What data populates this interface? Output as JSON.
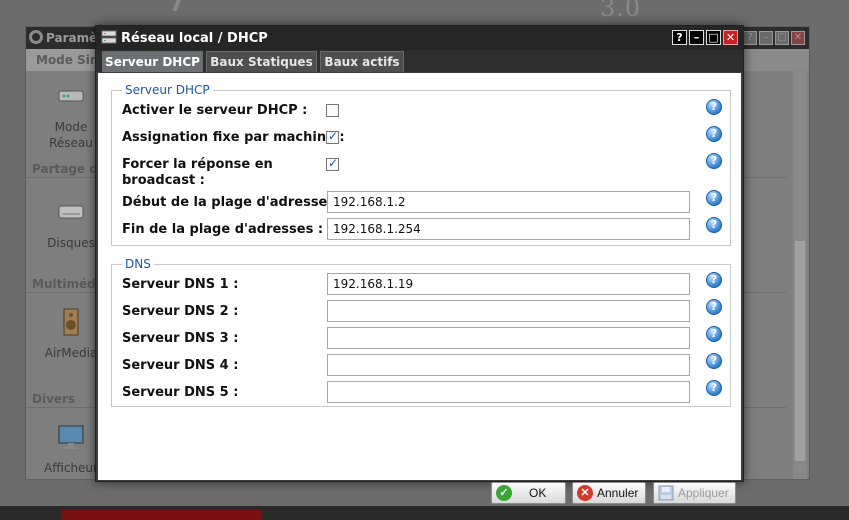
{
  "background": {
    "watermark": "3.0",
    "window_title": "Paramè",
    "tab_partial": "Mode Sim",
    "sections": [
      "Partage d",
      "Multimédi",
      "Divers"
    ],
    "items": [
      {
        "label_line1": "Mode",
        "label_line2": "Réseau",
        "icon": "network-device-icon"
      },
      {
        "label_line1": "Disques",
        "label_line2": "",
        "icon": "hard-disk-icon"
      },
      {
        "label_line1": "AirMedia",
        "label_line2": "",
        "icon": "speaker-icon"
      },
      {
        "label_line1": "Afficheur",
        "label_line2": "",
        "icon": "monitor-icon"
      }
    ],
    "window_buttons": [
      "?",
      "–",
      "□",
      "✕"
    ]
  },
  "dialog": {
    "title": "Réseau local / DHCP",
    "window_buttons": {
      "help": "?",
      "minimize": "–",
      "maximize": "□",
      "close": "✕"
    },
    "tabs": [
      {
        "label": "Serveur DHCP",
        "active": true
      },
      {
        "label": "Baux Statiques",
        "active": false
      },
      {
        "label": "Baux actifs",
        "active": false
      }
    ],
    "dhcp_group": {
      "legend": "Serveur DHCP",
      "enable": {
        "label": "Activer le serveur DHCP :",
        "checked": false
      },
      "fixed": {
        "label": "Assignation fixe par machine :",
        "checked": true
      },
      "broadcast": {
        "label_line1": "Forcer la réponse en",
        "label_line2": "broadcast :",
        "checked": true
      },
      "range_start": {
        "label": "Début de la plage d'adresses :",
        "value": "192.168.1.2"
      },
      "range_end": {
        "label": "Fin de la plage d'adresses :",
        "value": "192.168.1.254"
      }
    },
    "dns_group": {
      "legend": "DNS",
      "servers": [
        {
          "label": "Serveur DNS 1 :",
          "value": "192.168.1.19"
        },
        {
          "label": "Serveur DNS 2 :",
          "value": ""
        },
        {
          "label": "Serveur DNS 3 :",
          "value": ""
        },
        {
          "label": "Serveur DNS 4 :",
          "value": ""
        },
        {
          "label": "Serveur DNS 5 :",
          "value": ""
        }
      ]
    },
    "help_glyph": "?",
    "buttons": {
      "ok": "OK",
      "cancel": "Annuler",
      "apply": "Appliquer"
    }
  },
  "colors": {
    "accent": "#1f57a3",
    "close_red": "#c62020",
    "ok_green": "#3aa635",
    "cancel_red": "#d23b2b"
  }
}
